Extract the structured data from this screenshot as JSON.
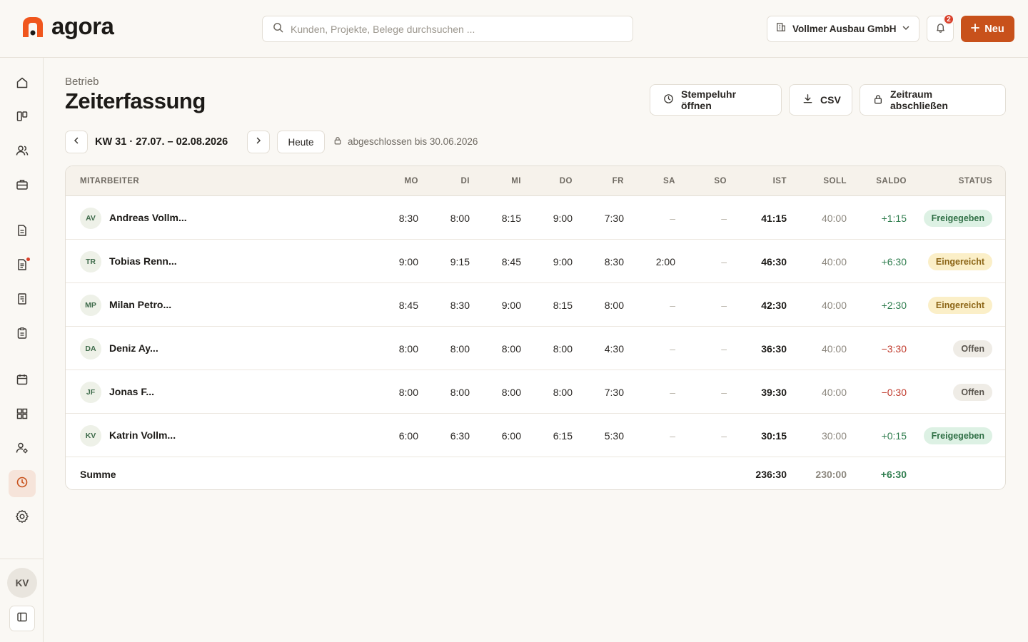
{
  "app": {
    "logo_text": "agora"
  },
  "search": {
    "placeholder": "Kunden, Projekte, Belege durchsuchen ..."
  },
  "company": {
    "name": "Vollmer Ausbau GmbH"
  },
  "notifications": {
    "count": "2"
  },
  "new_button": {
    "label": "Neu"
  },
  "sidebar": {
    "items": [
      {
        "icon": "home-icon"
      },
      {
        "icon": "board-icon"
      },
      {
        "icon": "users-icon"
      },
      {
        "icon": "briefcase-icon"
      },
      {
        "icon": "document-icon"
      },
      {
        "icon": "invoice-icon",
        "notification": true
      },
      {
        "icon": "receipt-icon"
      },
      {
        "icon": "clipboard-icon"
      },
      {
        "icon": "calendar-icon"
      },
      {
        "icon": "grid-icon"
      },
      {
        "icon": "user-settings-icon"
      },
      {
        "icon": "clock-icon",
        "active": true
      },
      {
        "icon": "gear-icon"
      }
    ],
    "user_initials": "KV"
  },
  "page": {
    "breadcrumb": "Betrieb",
    "title": "Zeiterfassung",
    "actions": {
      "clock": "Stempeluhr öffnen",
      "csv": "CSV",
      "close_period": "Zeitraum abschließen"
    }
  },
  "week": {
    "label": "KW 31 · 27.07. – 02.08.2026",
    "today": "Heute",
    "locked_text": "abgeschlossen bis 30.06.2026"
  },
  "table": {
    "headers": {
      "employee": "MITARBEITER",
      "mo": "MO",
      "di": "DI",
      "mi": "MI",
      "do": "DO",
      "fr": "FR",
      "sa": "SA",
      "so": "SO",
      "ist": "IST",
      "soll": "SOLL",
      "saldo": "SALDO",
      "status": "STATUS"
    },
    "rows": [
      {
        "initials": "AV",
        "name": "Andreas Vollm...",
        "mo": "8:30",
        "di": "8:00",
        "mi": "8:15",
        "do": "9:00",
        "fr": "7:30",
        "sa": "–",
        "so": "–",
        "ist": "41:15",
        "soll": "40:00",
        "saldo": "+1:15",
        "status": "Freigegeben"
      },
      {
        "initials": "TR",
        "name": "Tobias Renn...",
        "mo": "9:00",
        "di": "9:15",
        "mi": "8:45",
        "do": "9:00",
        "fr": "8:30",
        "sa": "2:00",
        "so": "–",
        "ist": "46:30",
        "soll": "40:00",
        "saldo": "+6:30",
        "status": "Eingereicht"
      },
      {
        "initials": "MP",
        "name": "Milan Petro...",
        "mo": "8:45",
        "di": "8:30",
        "mi": "9:00",
        "do": "8:15",
        "fr": "8:00",
        "sa": "–",
        "so": "–",
        "ist": "42:30",
        "soll": "40:00",
        "saldo": "+2:30",
        "status": "Eingereicht"
      },
      {
        "initials": "DA",
        "name": "Deniz Ay...",
        "mo": "8:00",
        "di": "8:00",
        "mi": "8:00",
        "do": "8:00",
        "fr": "4:30",
        "sa": "–",
        "so": "–",
        "ist": "36:30",
        "soll": "40:00",
        "saldo": "−3:30",
        "status": "Offen"
      },
      {
        "initials": "JF",
        "name": "Jonas F...",
        "mo": "8:00",
        "di": "8:00",
        "mi": "8:00",
        "do": "8:00",
        "fr": "7:30",
        "sa": "–",
        "so": "–",
        "ist": "39:30",
        "soll": "40:00",
        "saldo": "−0:30",
        "status": "Offen"
      },
      {
        "initials": "KV",
        "name": "Katrin Vollm...",
        "mo": "6:00",
        "di": "6:30",
        "mi": "6:00",
        "do": "6:15",
        "fr": "5:30",
        "sa": "–",
        "so": "–",
        "ist": "30:15",
        "soll": "30:00",
        "saldo": "+0:15",
        "status": "Freigegeben"
      }
    ],
    "summary": {
      "label": "Summe",
      "ist": "236:30",
      "soll": "230:00",
      "saldo": "+6:30"
    }
  },
  "colors": {
    "accent": "#c8511b",
    "positive": "#2f7d4e",
    "negative": "#c0392b",
    "status_freigegeben": "#ddf1e4",
    "status_eingereicht": "#fbefc8",
    "status_offen": "#efece6"
  }
}
